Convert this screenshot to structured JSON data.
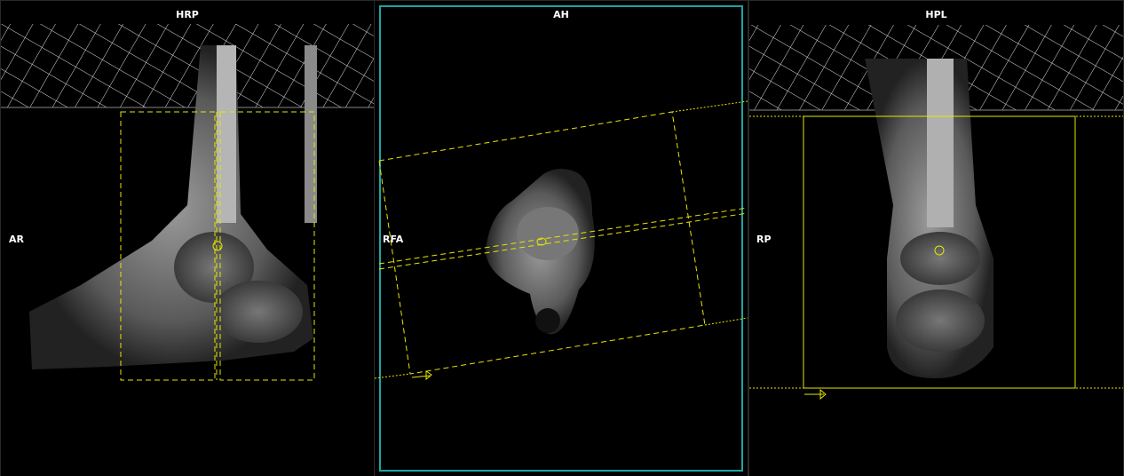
{
  "viewports": [
    {
      "title": "HRP",
      "side_label": "AR",
      "view": "sagittal",
      "active": false
    },
    {
      "title": "AH",
      "side_label": "RFA",
      "view": "axial",
      "active": true
    },
    {
      "title": "HPL",
      "side_label": "RP",
      "view": "coronal",
      "active": false
    }
  ],
  "colors": {
    "planning_overlay": "#e6e600",
    "active_border": "#1fa3a3",
    "background": "#000000",
    "panel_border": "#3a3a3a"
  }
}
